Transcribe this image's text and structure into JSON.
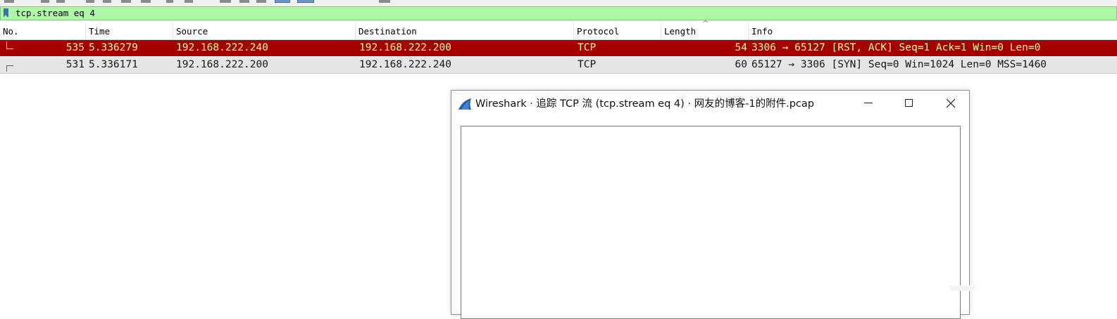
{
  "filter": {
    "expression": "tcp.stream eq 4",
    "background": "#aff8a8"
  },
  "packet_list": {
    "columns": [
      "No.",
      "Time",
      "Source",
      "Destination",
      "Protocol",
      "Length",
      "Info"
    ],
    "sort_column": "Length",
    "rows": [
      {
        "no": "535",
        "time": "5.336279",
        "source": "192.168.222.240",
        "destination": "192.168.222.200",
        "protocol": "TCP",
        "length": "54",
        "info": "3306 → 65127 [RST, ACK] Seq=1 Ack=1 Win=0 Len=0",
        "selected": true,
        "background": "#a40000",
        "foreground": "#fffc9c"
      },
      {
        "no": "531",
        "time": "5.336171",
        "source": "192.168.222.200",
        "destination": "192.168.222.240",
        "protocol": "TCP",
        "length": "60",
        "info": "65127 → 3306 [SYN] Seq=0 Win=1024 Len=0 MSS=1460",
        "selected": false,
        "background": "#e6e6e6",
        "foreground": "#151515"
      }
    ]
  },
  "dialog": {
    "title": "Wireshark · 追踪 TCP 流 (tcp.stream eq 4) · 网友的博客-1的附件.pcap",
    "icon": "wireshark-fin-icon",
    "stream_content": ""
  }
}
